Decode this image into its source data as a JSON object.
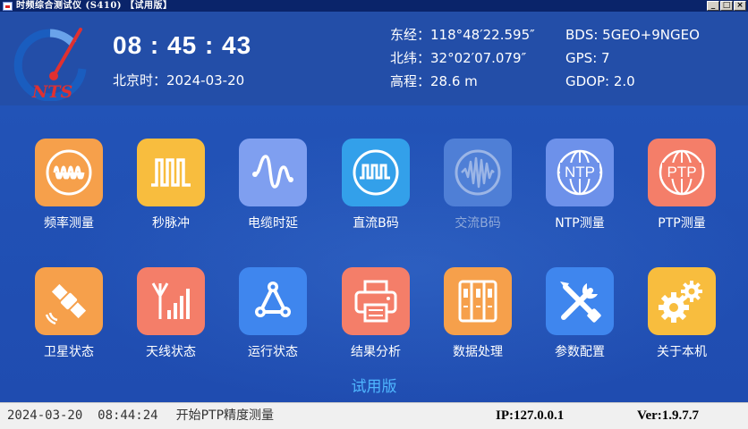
{
  "window": {
    "title": "时频综合测试仪 (S410) 【试用版】",
    "controls": [
      "_",
      "□",
      "×"
    ]
  },
  "header": {
    "logo_text": "NTS",
    "time": "08 : 45 : 43",
    "beijing_time": "北京时：2024-03-20",
    "longitude": "东经：118°48′22.595″",
    "latitude": "北纬：32°02′07.079″",
    "altitude": "高程：28.6 m",
    "bds": "BDS: 5GEO+9NGEO",
    "gps": "GPS: 7",
    "gdop": "GDOP: 2.0"
  },
  "tiles": [
    {
      "label": "频率测量",
      "icon": "frequency-wave-icon",
      "color": "#f6a04b",
      "enabled": true
    },
    {
      "label": "秒脉冲",
      "icon": "pulse-icon",
      "color": "#f8bd3e",
      "enabled": true
    },
    {
      "label": "电缆时延",
      "icon": "cable-delay-icon",
      "color": "#7f9ff0",
      "enabled": true
    },
    {
      "label": "直流B码",
      "icon": "dc-bcode-icon",
      "color": "#33a0ea",
      "enabled": true
    },
    {
      "label": "交流B码",
      "icon": "ac-bcode-icon",
      "color": "#4f7fd6",
      "enabled": false
    },
    {
      "label": "NTP测量",
      "icon": "ntp-globe-icon",
      "color": "#6d91ea",
      "enabled": true
    },
    {
      "label": "PTP测量",
      "icon": "ptp-globe-icon",
      "color": "#f47e69",
      "enabled": true
    },
    {
      "label": "卫星状态",
      "icon": "satellite-icon",
      "color": "#f6a04b",
      "enabled": true
    },
    {
      "label": "天线状态",
      "icon": "antenna-icon",
      "color": "#f47e69",
      "enabled": true
    },
    {
      "label": "运行状态",
      "icon": "run-status-icon",
      "color": "#3f86ee",
      "enabled": true
    },
    {
      "label": "结果分析",
      "icon": "printer-icon",
      "color": "#f47e69",
      "enabled": true
    },
    {
      "label": "数据处理",
      "icon": "data-process-icon",
      "color": "#f6a04b",
      "enabled": true
    },
    {
      "label": "参数配置",
      "icon": "tools-icon",
      "color": "#3f86ee",
      "enabled": true
    },
    {
      "label": "关于本机",
      "icon": "gears-icon",
      "color": "#f8bd3e",
      "enabled": true
    }
  ],
  "trial_label": "试用版",
  "status": {
    "datetime": "2024-03-20  08:44:24",
    "message": "开始PTP精度测量",
    "ip": "IP:127.0.0.1",
    "version": "Ver:1.9.7.7"
  }
}
